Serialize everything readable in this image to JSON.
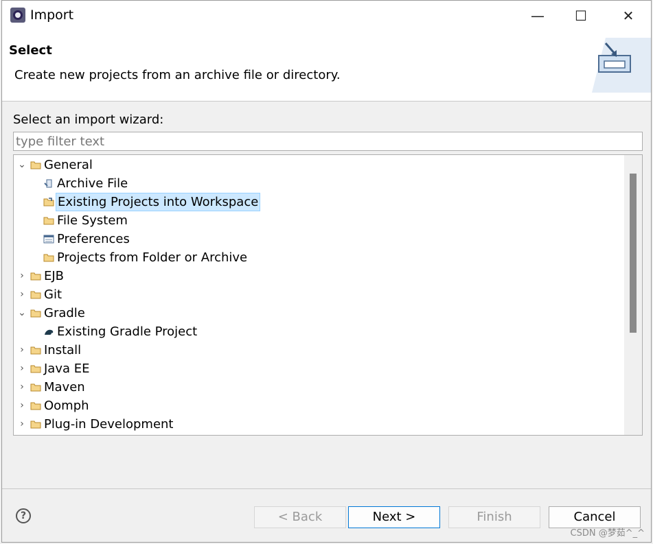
{
  "window": {
    "title": "Import",
    "controls": {
      "minimize": "—",
      "maximize": "☐",
      "close": "✕"
    }
  },
  "header": {
    "title": "Select",
    "description": "Create new projects from an archive file or directory."
  },
  "wizard": {
    "label": "Select an import wizard:",
    "filter_placeholder": "type filter text",
    "tree": [
      {
        "label": "General",
        "expanded": true,
        "icon": "folder-icon"
      },
      {
        "label": "Archive File",
        "icon": "archive-icon"
      },
      {
        "label": "Existing Projects into Workspace",
        "icon": "projects-icon",
        "selected": true
      },
      {
        "label": "File System",
        "icon": "folder-icon"
      },
      {
        "label": "Preferences",
        "icon": "preferences-icon"
      },
      {
        "label": "Projects from Folder or Archive",
        "icon": "folder-icon"
      },
      {
        "label": "EJB",
        "expanded": false,
        "icon": "folder-icon"
      },
      {
        "label": "Git",
        "expanded": false,
        "icon": "folder-icon"
      },
      {
        "label": "Gradle",
        "expanded": true,
        "icon": "folder-icon"
      },
      {
        "label": "Existing Gradle Project",
        "icon": "gradle-icon"
      },
      {
        "label": "Install",
        "expanded": false,
        "icon": "folder-icon"
      },
      {
        "label": "Java EE",
        "expanded": false,
        "icon": "folder-icon"
      },
      {
        "label": "Maven",
        "expanded": false,
        "icon": "folder-icon"
      },
      {
        "label": "Oomph",
        "expanded": false,
        "icon": "folder-icon"
      },
      {
        "label": "Plug-in Development",
        "expanded": false,
        "icon": "folder-icon"
      }
    ]
  },
  "buttons": {
    "back": "< Back",
    "next": "Next >",
    "finish": "Finish",
    "cancel": "Cancel",
    "help": "?"
  },
  "watermark": "CSDN @梦茹^_^"
}
